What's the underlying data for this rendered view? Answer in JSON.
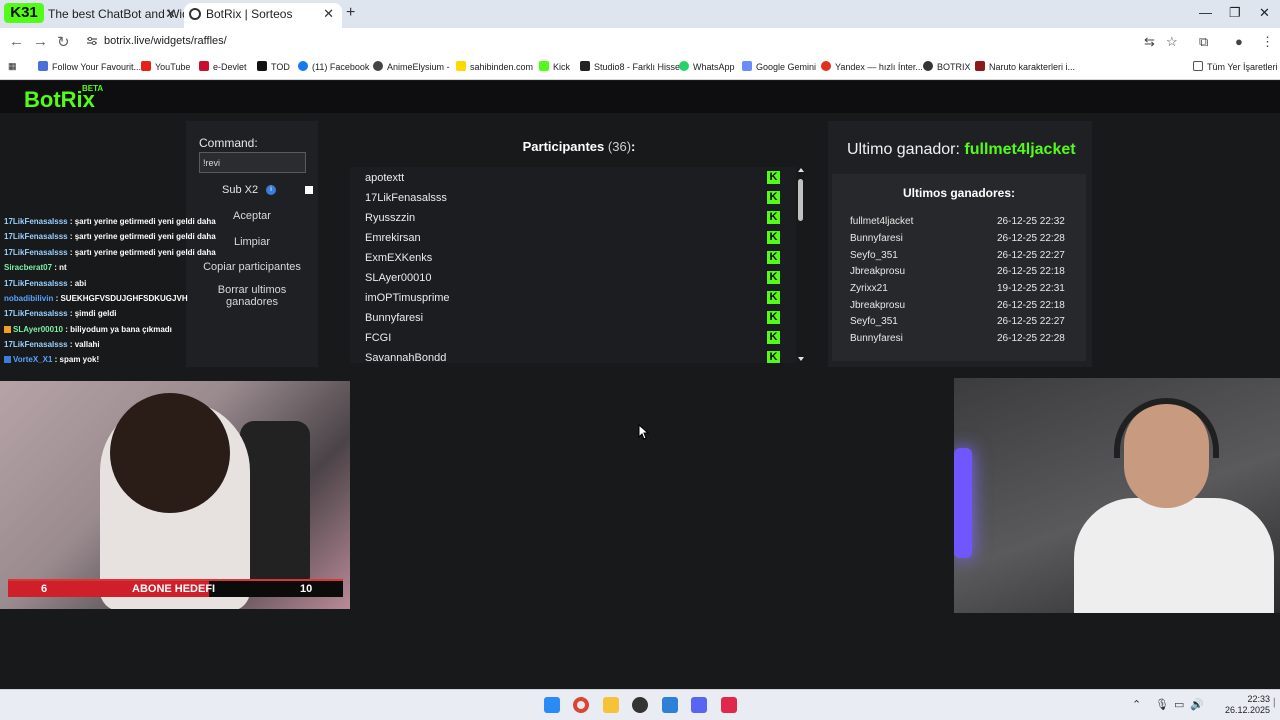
{
  "browser": {
    "tabs": [
      {
        "title": "The best ChatBot and Widgets"
      },
      {
        "title": "BotRix | Sorteos"
      }
    ],
    "kick_badge": "31",
    "url": "botrix.live/widgets/raffles/",
    "bookmarks": [
      "Follow Your Favourit...",
      "YouTube",
      "e-Devlet",
      "TOD",
      "(11) Facebook",
      "AnimeElysium -",
      "sahibinden.com",
      "Kick",
      "Studio8 - Farklı Hisset",
      "WhatsApp",
      "Google Gemini",
      "Yandex — hızlı İnter...",
      "BOTRIX",
      "Naruto karakterleri i..."
    ],
    "all_bookmarks": "Tüm Yer İşaretleri"
  },
  "header": {
    "brand": "BotRix",
    "beta": "BETA"
  },
  "command_panel": {
    "label": "Command:",
    "value": "!revi",
    "sub_label": "Sub X2",
    "accept": "Aceptar",
    "clear": "Limpiar",
    "copy": "Copiar participantes",
    "delete": "Borrar ultimos ganadores"
  },
  "chat": [
    {
      "user": "17LikFenasalsss",
      "msg": ": şartı yerine getirmedi yeni geldi daha"
    },
    {
      "user": "17LikFenasalsss",
      "msg": ": şartı yerine getirmedi yeni geldi daha"
    },
    {
      "user": "17LikFenasalsss",
      "msg": ": şartı yerine getirmedi yeni geldi daha"
    },
    {
      "user": "Siracberat07",
      "msg": ": nt"
    },
    {
      "user": "17LikFenasalsss",
      "msg": ": abi"
    },
    {
      "user": "nobadibilivin",
      "msg": ": SUEKHGFVSDUJGHFSDKUGJVH"
    },
    {
      "user": "17LikFenasalsss",
      "msg": ": şimdi geldi"
    },
    {
      "user": "SLAyer00010",
      "msg": ": biliyodum ya bana çıkmadı"
    },
    {
      "user": "17LikFenasalsss",
      "msg": ": vallahi"
    },
    {
      "user": "VorteX_X1",
      "msg": ": spam yok!"
    }
  ],
  "participants": {
    "title": "Participantes",
    "count": "(36)",
    "suffix": ":",
    "list": [
      "apotextt",
      "17LikFenasalsss",
      "Ryusszzin",
      "Emrekirsan",
      "ExmEXKenks",
      "SLAyer00010",
      "imOPTimusprime",
      "Bunnyfaresi",
      "FCGI",
      "SavannahBondd"
    ],
    "badge": "K"
  },
  "winners": {
    "last_label": "Ultimo ganador:",
    "last_winner": "fullmet4ljacket",
    "list_title": "Ultimos ganadores:",
    "rows": [
      {
        "name": "fullmet4ljacket",
        "date": "26-12-25 22:32"
      },
      {
        "name": "Bunnyfaresi",
        "date": "26-12-25 22:28"
      },
      {
        "name": "Seyfo_351",
        "date": "26-12-25 22:27"
      },
      {
        "name": "Jbreakprosu",
        "date": "26-12-25 22:18"
      },
      {
        "name": "Zyrixx21",
        "date": "19-12-25 22:31"
      },
      {
        "name": "Jbreakprosu",
        "date": "26-12-25 22:18"
      },
      {
        "name": "Seyfo_351",
        "date": "26-12-25 22:27"
      },
      {
        "name": "Bunnyfaresi",
        "date": "26-12-25 22:28"
      }
    ]
  },
  "sub_goal": {
    "current": "6",
    "label": "ABONE HEDEFI",
    "target": "10",
    "progress": 0.6
  },
  "taskbar": {
    "time": "22:33",
    "date": "26.12.2025"
  },
  "colors": {
    "kick_green": "#53fc18",
    "goal_red": "#cf1f2a"
  }
}
